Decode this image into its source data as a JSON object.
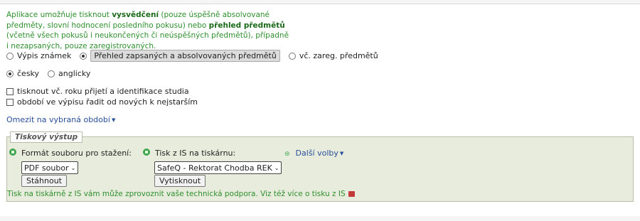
{
  "intro": {
    "part1": "Aplikace umožňuje tisknout ",
    "bold1": "vysvědčení",
    "part2": " (pouze úspěšně absolvované předměty, slovní hodnocení posledního pokusu) nebo ",
    "bold2": "přehled předmětů",
    "part3": " (včetně všech pokusů i neukončených či neúspěšných předmětů), případně i nezapsaných, pouze zaregistrovaných."
  },
  "report_type": {
    "options": [
      "Výpis známek",
      "Přehled zapsaných a absolvovaných předmětů",
      "vč. zareg. předmětů"
    ],
    "selected": "Přehled zapsaných a absolvovaných předmětů"
  },
  "language": {
    "options": [
      "česky",
      "anglicky"
    ],
    "selected": "česky"
  },
  "checkboxes": {
    "c1": "tisknout vč. roku přijetí a identifikace studia",
    "c2": "období ve výpisu řadit od nových k nejstarším"
  },
  "limit_link": "Omezit na vybraná období",
  "output": {
    "legend": "Tiskový výstup",
    "format_label": "Formát souboru pro stažení:",
    "format_value": "PDF soubor",
    "download_button": "Stáhnout",
    "printer_label": "Tisk z IS na tiskárnu:",
    "printer_value": "SafeQ - Rektorat Chodba REK",
    "print_button": "Vytisknout",
    "more_options": "Další volby",
    "note": "Tisk na tiskárně z IS vám může zprovoznit vaše technická podpora. Viz též více o tisku z IS"
  }
}
